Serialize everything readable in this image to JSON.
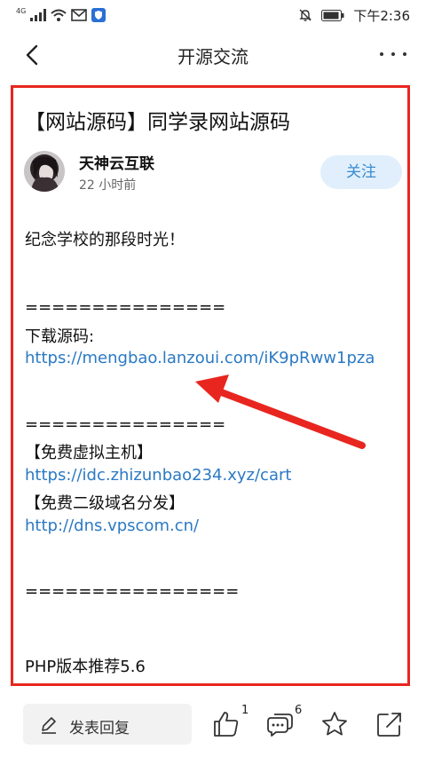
{
  "status_bar": {
    "network": "4G",
    "time": "下午2:36"
  },
  "nav": {
    "title": "开源交流"
  },
  "post": {
    "title": "【网站源码】同学录网站源码",
    "author": "天神云互联",
    "time": "22 小时前",
    "follow_label": "关注",
    "lines": {
      "intro": "纪念学校的那段时光！",
      "sep1": "===============",
      "download_label": "下载源码:",
      "download_url": "https://mengbao.lanzoui.com/iK9pRww1pza",
      "sep2": "===============",
      "vhost_label": "【免费虚拟主机】",
      "vhost_url": "https://idc.zhizunbao234.xyz/cart",
      "domain_label": "【免费二级域名分发】",
      "domain_url": "http://dns.vpscom.cn/",
      "sep3": "================",
      "php_note": "PHP版本推荐5.6"
    }
  },
  "bottom_bar": {
    "reply_label": "发表回复",
    "like_count": "1",
    "comment_count": "6"
  },
  "colors": {
    "highlight_border": "#e8261f",
    "link": "#2b79c3",
    "follow_bg": "#e0effb",
    "follow_text": "#3a8bd0"
  },
  "icons": [
    "back-icon",
    "more-icon",
    "thumbs-up-icon",
    "comment-icon",
    "star-icon",
    "share-icon",
    "pen-icon"
  ]
}
